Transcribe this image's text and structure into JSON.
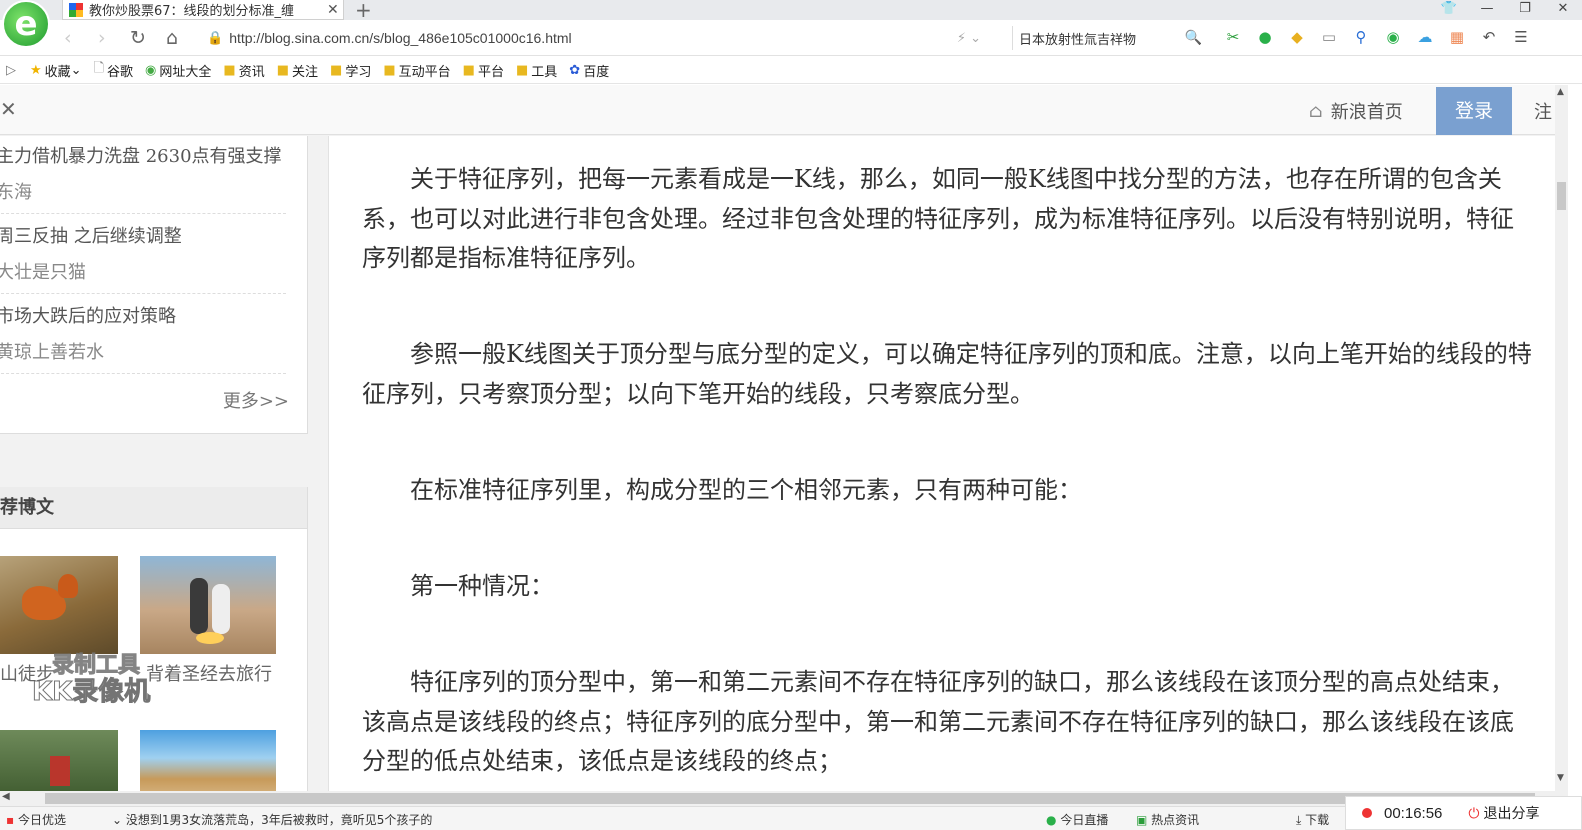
{
  "browser": {
    "tab_title": "教你炒股票67：线段的划分标准_缠",
    "url": "http://blog.sina.com.cn/s/blog_486e105c01000c16.html",
    "search_query": "日本放射性氚吉祥物",
    "logo_letter": "e"
  },
  "bookmarks": [
    {
      "label": "收藏",
      "icon": "star-icon"
    },
    {
      "label": "谷歌",
      "icon": "page-icon"
    },
    {
      "label": "网址大全",
      "icon": "globe-icon"
    },
    {
      "label": "资讯",
      "icon": "folder-icon"
    },
    {
      "label": "关注",
      "icon": "folder-icon"
    },
    {
      "label": "学习",
      "icon": "folder-icon"
    },
    {
      "label": "互动平台",
      "icon": "folder-icon"
    },
    {
      "label": "平台",
      "icon": "folder-icon"
    },
    {
      "label": "工具",
      "icon": "folder-icon"
    },
    {
      "label": "百度",
      "icon": "paw-icon"
    }
  ],
  "site_header": {
    "home_label": "新浪首页",
    "login_label": "登录",
    "register_label": "注"
  },
  "sidebar": {
    "related": [
      {
        "title": "主力借机暴力洗盘 2630点有强支撑",
        "author": "东海"
      },
      {
        "title": "周三反抽 之后继续调整",
        "author": "大壮是只猫"
      },
      {
        "title": "市场大跌后的应对策略",
        "author": "黄琼上善若水"
      }
    ],
    "more_label": "更多>>",
    "recommend_header": "荐博文",
    "recommend_captions": [
      "山徒步",
      "背着圣经去旅行"
    ],
    "watermark_line1": "录制工具",
    "watermark_line2": "KK录像机"
  },
  "article": {
    "paragraphs": [
      "关于特征序列，把每一元素看成是一K线，那么，如同一般K线图中找分型的方法，也存在所谓的包含关系，也可以对此进行非包含处理。经过非包含处理的特征序列，成为标准特征序列。以后没有特别说明，特征序列都是指标准特征序列。",
      "参照一般K线图关于顶分型与底分型的定义，可以确定特征序列的顶和底。注意，以向上笔开始的线段的特征序列，只考察顶分型；以向下笔开始的线段，只考察底分型。",
      "在标准特征序列里，构成分型的三个相邻元素，只有两种可能：",
      "第一种情况：",
      "特征序列的顶分型中，第一和第二元素间不存在特征序列的缺口，那么该线段在该顶分型的高点处结束，该高点是该线段的终点；特征序列的底分型中，第一和第二元素间不存在特征序列的缺口，那么该线段在该底分型的低点处结束，该低点是该线段的终点；"
    ]
  },
  "statusbar": {
    "left_label": "今日优选",
    "news": "没想到1男3女流落荒岛，3年后被救时，竟听见5个孩子的",
    "live_label": "今日直播",
    "hot_label": "热点资讯",
    "download_label": "下载"
  },
  "recorder": {
    "time": "00:16:56",
    "exit_label": "退出分享"
  }
}
